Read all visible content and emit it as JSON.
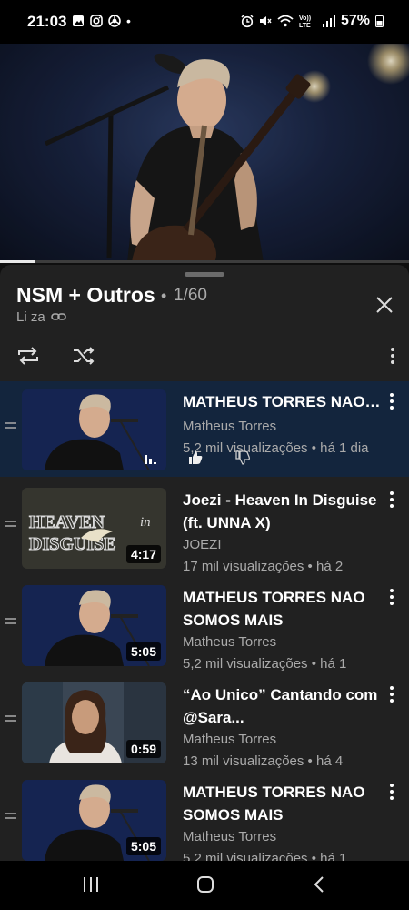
{
  "status_bar": {
    "time": "21:03",
    "dot": "•",
    "battery": "57%",
    "left_icons": [
      "gallery-icon",
      "instagram-icon",
      "chrome-icon"
    ],
    "right_icons": [
      "alarm-icon",
      "mute-icon",
      "wifi-icon",
      "volte-icon",
      "signal-icon",
      "battery-icon"
    ]
  },
  "player": {
    "progress_fraction": 0.085
  },
  "playlist": {
    "title": "NSM + Outros",
    "separator": "•",
    "position": "1/60",
    "owner": "Li za",
    "controls": [
      "loop-icon",
      "shuffle-icon",
      "more-icon",
      "close-icon"
    ]
  },
  "items": [
    {
      "title": "MATHEUS TORRES NAO SOMOS MAIS",
      "channel": "Matheus Torres",
      "meta": "5,2 mil visualizações • há 1 dia",
      "duration": "",
      "active": true,
      "thumb": "singer"
    },
    {
      "title": "Joezi - Heaven In Disguise (ft. UNNA X)",
      "channel": "JOEZI",
      "meta": "17 mil visualizações • há 2",
      "duration": "4:17",
      "active": false,
      "thumb": "heaven",
      "thumb_text_1": "HEAVEN",
      "thumb_text_2": "in",
      "thumb_text_3": "DISGUISE"
    },
    {
      "title": "MATHEUS TORRES NAO SOMOS MAIS",
      "channel": "Matheus Torres",
      "meta": "5,2 mil visualizações • há 1",
      "duration": "5:05",
      "active": false,
      "thumb": "singer"
    },
    {
      "title": "“Ao Unico” Cantando com @Sara...",
      "channel": "Matheus Torres",
      "meta": "13 mil visualizações • há 4",
      "duration": "0:59",
      "active": false,
      "thumb": "woman"
    },
    {
      "title": "MATHEUS TORRES NAO SOMOS MAIS",
      "channel": "Matheus Torres",
      "meta": "5,2 mil visualizações • há 1",
      "duration": "5:05",
      "active": false,
      "thumb": "singer"
    }
  ],
  "nav_bar": [
    "recent-apps-icon",
    "home-icon",
    "back-icon"
  ],
  "colors": {
    "background": "#0f0f0f",
    "panel": "#212121",
    "active_row": "#13253d",
    "secondary_text": "#aaaaaa"
  }
}
